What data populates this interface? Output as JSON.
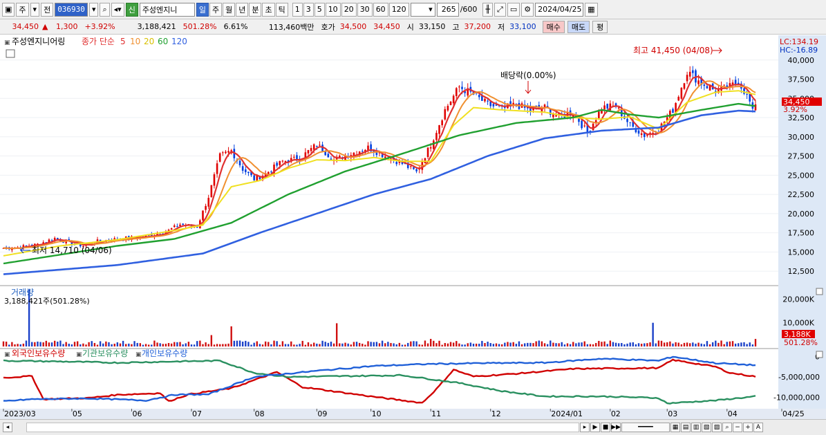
{
  "toolbar": {
    "market": "주",
    "prev": "전",
    "code": "036930",
    "new_badge": "신",
    "name": "주성엔지니",
    "periods": [
      "일",
      "주",
      "월",
      "년",
      "분",
      "초",
      "틱"
    ],
    "intervals": [
      "1",
      "3",
      "5",
      "10",
      "20",
      "30",
      "60",
      "120"
    ],
    "count": "265",
    "count_max": "/600",
    "date": "2024/04/25"
  },
  "quote": {
    "price": "34,450",
    "change_arrow": "▲",
    "change": "1,300",
    "change_pct": "+3.92%",
    "volume": "3,188,421",
    "volume_ratio": "501.28%",
    "turnover": "6.61%",
    "amount": "113,460백만",
    "bid_label": "호가",
    "bid": "34,500",
    "ask": "34,450",
    "open_label": "시",
    "open": "33,150",
    "high_label": "고",
    "high": "37,200",
    "low_label": "저",
    "low": "33,100",
    "buy_btn": "매수",
    "sell_btn": "매도",
    "eval_btn": "평"
  },
  "chart_data": [
    {
      "type": "candlestick",
      "title": "주성엔지니어링",
      "legend": [
        "종가 단순",
        "5",
        "10",
        "20",
        "60",
        "120"
      ],
      "colors": {
        "ma5": "#e03030",
        "ma10": "#f09030",
        "ma20": "#f0e020",
        "ma60": "#20a030",
        "ma120": "#3060e0",
        "up": "#e00000",
        "down": "#0040e0"
      },
      "yticks": [
        12500,
        15000,
        17500,
        20000,
        22500,
        25000,
        27500,
        30000,
        32500,
        35000,
        37500,
        40000
      ],
      "ylim": [
        10800,
        42500
      ],
      "lc": "LC:134.19",
      "hc": "HC:-16.89",
      "last_label": "34,450",
      "last_pct": "3.92%",
      "high_annot": "최고 41,450 (04/08)",
      "low_annot": "최저 14,710 (04/06)",
      "dividend_annot": "배당락(0.00%)",
      "close_points": [
        [
          0,
          15500
        ],
        [
          5,
          15600
        ],
        [
          12,
          16000
        ],
        [
          18,
          16800
        ],
        [
          22,
          16300
        ],
        [
          28,
          15800
        ],
        [
          33,
          16400
        ],
        [
          40,
          16700
        ],
        [
          50,
          17000
        ],
        [
          58,
          17800
        ],
        [
          62,
          18600
        ],
        [
          68,
          18300
        ],
        [
          72,
          22200
        ],
        [
          76,
          27500
        ],
        [
          80,
          28200
        ],
        [
          84,
          25800
        ],
        [
          88,
          24500
        ],
        [
          92,
          25200
        ],
        [
          98,
          26800
        ],
        [
          104,
          27200
        ],
        [
          110,
          29000
        ],
        [
          116,
          27000
        ],
        [
          122,
          27800
        ],
        [
          128,
          28600
        ],
        [
          134,
          27500
        ],
        [
          140,
          26500
        ],
        [
          145,
          25400
        ],
        [
          150,
          29000
        ],
        [
          155,
          33500
        ],
        [
          160,
          36500
        ],
        [
          165,
          35500
        ],
        [
          170,
          34200
        ],
        [
          175,
          33600
        ],
        [
          180,
          34200
        ],
        [
          185,
          33400
        ],
        [
          190,
          33800
        ],
        [
          195,
          32600
        ],
        [
          200,
          33200
        ],
        [
          205,
          30500
        ],
        [
          210,
          33800
        ],
        [
          215,
          34000
        ],
        [
          220,
          31500
        ],
        [
          225,
          30200
        ],
        [
          230,
          31000
        ],
        [
          235,
          33500
        ],
        [
          240,
          38500
        ],
        [
          245,
          37000
        ],
        [
          250,
          36000
        ],
        [
          255,
          36500
        ],
        [
          258,
          37200
        ],
        [
          260,
          36000
        ],
        [
          262,
          34500
        ],
        [
          263,
          33200
        ],
        [
          264,
          34450
        ]
      ],
      "ma_points": {
        "ma20": [
          [
            0,
            14500
          ],
          [
            20,
            15800
          ],
          [
            40,
            16600
          ],
          [
            60,
            17800
          ],
          [
            70,
            18500
          ],
          [
            80,
            23500
          ],
          [
            90,
            24300
          ],
          [
            100,
            25900
          ],
          [
            110,
            27000
          ],
          [
            120,
            26900
          ],
          [
            130,
            27300
          ],
          [
            140,
            26800
          ],
          [
            150,
            26800
          ],
          [
            158,
            31500
          ],
          [
            165,
            33800
          ],
          [
            175,
            33500
          ],
          [
            190,
            33200
          ],
          [
            200,
            32500
          ],
          [
            210,
            32300
          ],
          [
            220,
            32600
          ],
          [
            230,
            31000
          ],
          [
            240,
            34500
          ],
          [
            250,
            35800
          ],
          [
            258,
            36000
          ],
          [
            264,
            35500
          ]
        ],
        "ma60": [
          [
            0,
            13500
          ],
          [
            40,
            15800
          ],
          [
            60,
            16700
          ],
          [
            80,
            18800
          ],
          [
            100,
            22500
          ],
          [
            120,
            25500
          ],
          [
            140,
            27800
          ],
          [
            160,
            30200
          ],
          [
            180,
            31800
          ],
          [
            200,
            32500
          ],
          [
            210,
            33500
          ],
          [
            220,
            32900
          ],
          [
            230,
            32500
          ],
          [
            245,
            33500
          ],
          [
            258,
            34300
          ],
          [
            264,
            34000
          ]
        ],
        "ma120": [
          [
            0,
            12100
          ],
          [
            40,
            13300
          ],
          [
            70,
            14800
          ],
          [
            90,
            17500
          ],
          [
            110,
            20000
          ],
          [
            130,
            22500
          ],
          [
            150,
            24500
          ],
          [
            170,
            27500
          ],
          [
            190,
            29800
          ],
          [
            210,
            30800
          ],
          [
            230,
            31200
          ],
          [
            245,
            32800
          ],
          [
            258,
            33400
          ],
          [
            264,
            33300
          ]
        ]
      },
      "x_labels": [
        "2023/03",
        "05",
        "06",
        "07",
        "08",
        "09",
        "10",
        "11",
        "12",
        "2024/01",
        "02",
        "03",
        "04",
        "04/25"
      ],
      "x_label_index": [
        0,
        24,
        45,
        66,
        88,
        110,
        129,
        150,
        171,
        192,
        213,
        233,
        254,
        264
      ]
    },
    {
      "type": "bar",
      "title": "거래량",
      "value_label": "3,188,421주(501.28%)",
      "yticks": [
        "20,000K",
        "10,000K"
      ],
      "yvalues": [
        20000,
        10000
      ],
      "last_label": "3,188K",
      "last_pct": "501.28%",
      "spikes": [
        [
          9,
          24000
        ],
        [
          73,
          4800
        ],
        [
          80,
          8500
        ],
        [
          117,
          9800
        ],
        [
          150,
          3200
        ],
        [
          228,
          10000
        ],
        [
          264,
          3188
        ]
      ],
      "base": 1400
    },
    {
      "type": "line",
      "legend": [
        "외국인보유수량",
        "기관보유수량",
        "개인보유수량"
      ],
      "yticks": [
        "0",
        "-5,000,000",
        "-10,000,000"
      ],
      "yvalues": [
        0,
        -5000000,
        -10000000
      ],
      "series": [
        {
          "name": "외국인보유수량",
          "color": "#d00000",
          "points": [
            [
              0,
              -5200000
            ],
            [
              10,
              -4800000
            ],
            [
              14,
              -10500000
            ],
            [
              30,
              -10200000
            ],
            [
              40,
              -9400000
            ],
            [
              55,
              -9000000
            ],
            [
              58,
              -11000000
            ],
            [
              65,
              -9300000
            ],
            [
              80,
              -7800000
            ],
            [
              96,
              -3800000
            ],
            [
              105,
              -7500000
            ],
            [
              130,
              -9900000
            ],
            [
              147,
              -11400000
            ],
            [
              152,
              -8000000
            ],
            [
              158,
              -3200000
            ],
            [
              165,
              -4900000
            ],
            [
              180,
              -4200000
            ],
            [
              200,
              -3000000
            ],
            [
              230,
              -2800000
            ],
            [
              235,
              -800000
            ],
            [
              250,
              -2500000
            ],
            [
              255,
              -4000000
            ],
            [
              264,
              -4900000
            ]
          ]
        },
        {
          "name": "기관보유수량",
          "color": "#2a9060",
          "points": [
            [
              0,
              -1000000
            ],
            [
              20,
              -1200000
            ],
            [
              40,
              -1500000
            ],
            [
              60,
              -1200000
            ],
            [
              76,
              -1000000
            ],
            [
              88,
              -4000000
            ],
            [
              100,
              -5000000
            ],
            [
              120,
              -4800000
            ],
            [
              140,
              -4600000
            ],
            [
              160,
              -6500000
            ],
            [
              175,
              -8500000
            ],
            [
              190,
              -9800000
            ],
            [
              210,
              -9800000
            ],
            [
              230,
              -10200000
            ],
            [
              233,
              -11500000
            ],
            [
              250,
              -10800000
            ],
            [
              264,
              -9800000
            ]
          ]
        },
        {
          "name": "개인보유수량",
          "color": "#2060d8",
          "points": [
            [
              0,
              -11000000
            ],
            [
              10,
              -10500000
            ],
            [
              30,
              -10300000
            ],
            [
              50,
              -10800000
            ],
            [
              60,
              -9400000
            ],
            [
              72,
              -9300000
            ],
            [
              88,
              -5000000
            ],
            [
              110,
              -3500000
            ],
            [
              130,
              -2300000
            ],
            [
              150,
              -1800000
            ],
            [
              170,
              -1600000
            ],
            [
              190,
              -1500000
            ],
            [
              210,
              -500000
            ],
            [
              230,
              -1000000
            ],
            [
              235,
              0
            ],
            [
              250,
              -1600000
            ],
            [
              264,
              -2100000
            ]
          ]
        }
      ]
    }
  ]
}
